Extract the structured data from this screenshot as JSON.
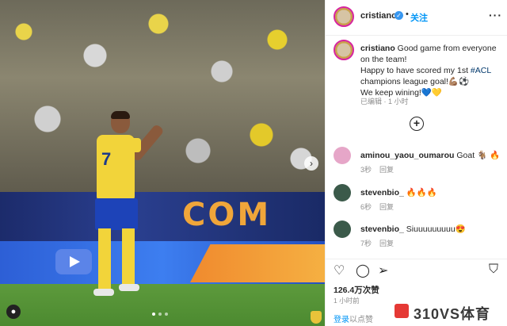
{
  "post": {
    "username": "cristiano",
    "follow_label": "关注",
    "separator": "•",
    "more_label": "···",
    "caption_username": "cristiano",
    "caption_line1": " Good game from everyone on the team!",
    "caption_line2": "Happy to have scored my 1st ",
    "caption_hashtag": "#ACL",
    "caption_line3": " champions league goal!💪🏽⚽",
    "caption_line4": "We keep wining!💙💛",
    "caption_meta": "已编辑 · 1 小时",
    "board_text": "COM",
    "photo_dots": 3,
    "active_dot": 0
  },
  "comments": [
    {
      "username": "aminou_yaou_oumarou",
      "text": "Goat 🐐 🔥",
      "time": "3秒",
      "reply": "回复",
      "avatar_color": "#e6a6c8"
    },
    {
      "username": "stevenbio_",
      "text": "🔥🔥🔥",
      "time": "6秒",
      "reply": "回复",
      "avatar_color": "#3b5a4a"
    },
    {
      "username": "stevenbio_",
      "text": "Siuuuuuuuuu😍",
      "time": "7秒",
      "reply": "回复",
      "avatar_color": "#3b5a4a"
    }
  ],
  "stats": {
    "likes": "126.4万次赞",
    "time": "1 小时前"
  },
  "footer": {
    "login_prefix": "登录",
    "login_rest": "以点赞"
  },
  "watermark": {
    "text": "310VS体育",
    "logo_color": "#e53935"
  }
}
